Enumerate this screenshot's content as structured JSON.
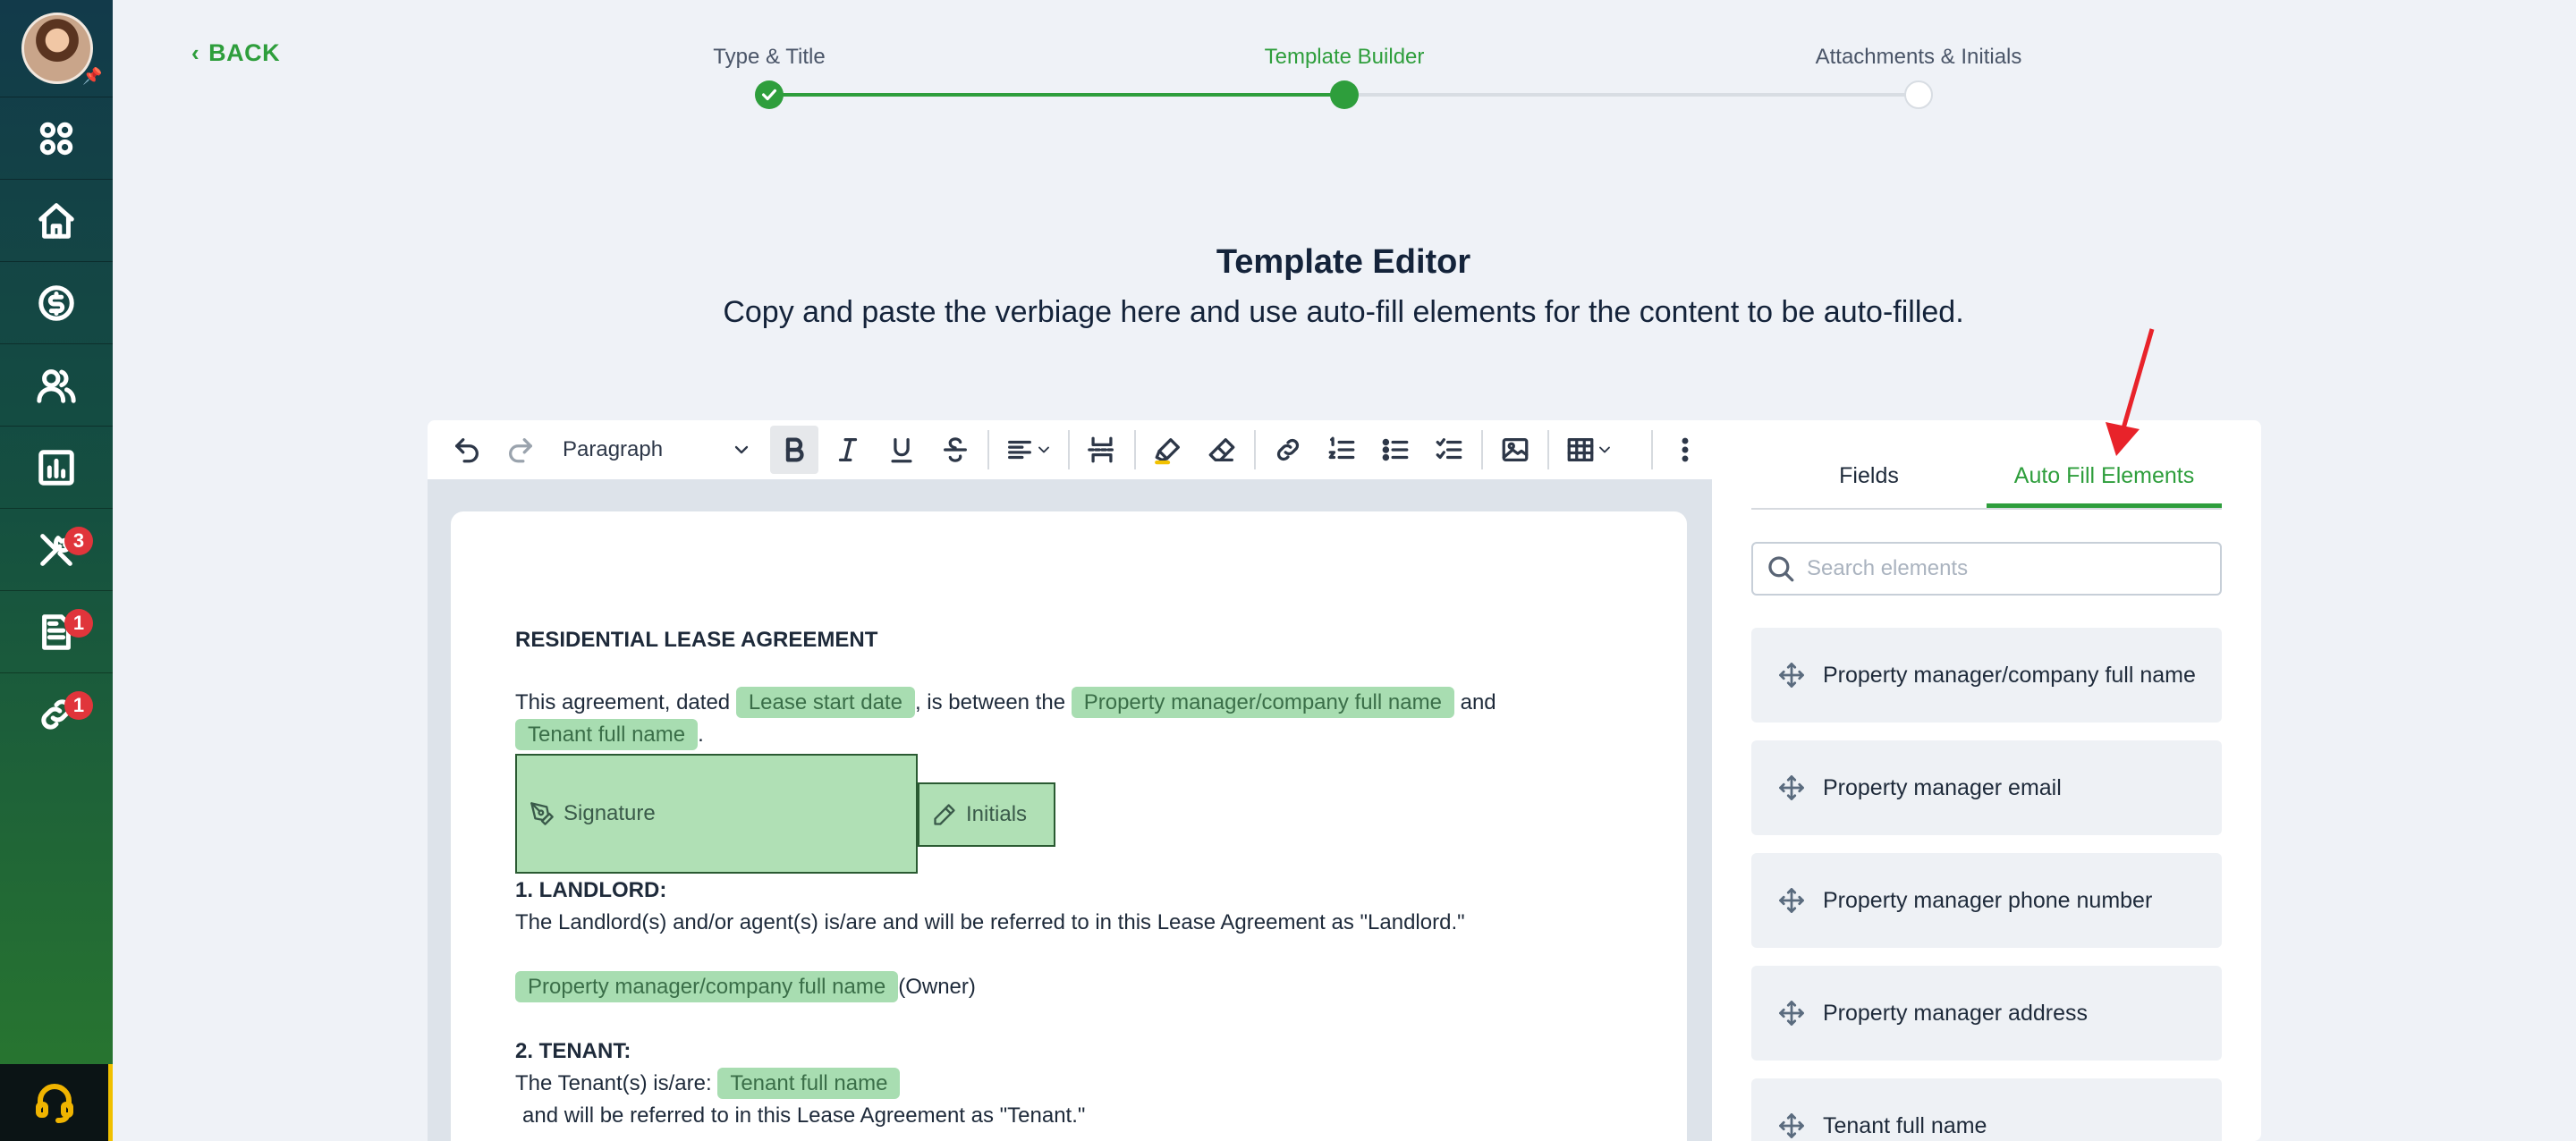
{
  "nav": {
    "back_label": "BACK",
    "items": [
      {
        "name": "apps-icon"
      },
      {
        "name": "home-icon"
      },
      {
        "name": "dollar-icon"
      },
      {
        "name": "users-icon"
      },
      {
        "name": "chart-icon"
      },
      {
        "name": "tools-icon",
        "badge": "3"
      },
      {
        "name": "document-icon",
        "badge": "1"
      },
      {
        "name": "link-icon",
        "badge": "1"
      }
    ],
    "support_icon": "headset-icon"
  },
  "stepper": {
    "steps": [
      {
        "label": "Type & Title",
        "state": "complete"
      },
      {
        "label": "Template Builder",
        "state": "active"
      },
      {
        "label": "Attachments & Initials",
        "state": "pending"
      }
    ],
    "accent_color": "#2e9e3c"
  },
  "header": {
    "title": "Template Editor",
    "subtitle": "Copy and paste the verbiage here and use auto-fill elements for the content to be auto-filled."
  },
  "toolbar": {
    "paragraph_style": "Paragraph"
  },
  "document": {
    "heading": "RESIDENTIAL LEASE AGREEMENT",
    "intro_prefix": "This agreement, dated",
    "intro_chip_1": "Lease start date",
    "intro_mid": ", is between the",
    "intro_chip_2": "Property manager/company full name",
    "intro_and": "and",
    "intro_chip_3": "Tenant full name",
    "intro_end": ".",
    "signature_label": "Signature",
    "initials_label": "Initials",
    "landlord_heading": "1. LANDLORD:",
    "landlord_text": "The Landlord(s) and/or agent(s) is/are and will be referred to in this Lease Agreement as \"Landlord.\"",
    "landlord_chip": "Property manager/company full name",
    "landlord_suffix": "(Owner)",
    "tenant_heading": "2. TENANT:",
    "tenant_prefix": "The Tenant(s) is/are:",
    "tenant_chip": "Tenant full name",
    "tenant_text": "and will be referred to in this Lease Agreement as \"Tenant.\""
  },
  "panel": {
    "tabs": [
      "Fields",
      "Auto Fill Elements"
    ],
    "active_tab": "Auto Fill Elements",
    "search_placeholder": "Search elements",
    "elements": [
      "Property manager/company full name",
      "Property manager email",
      "Property manager phone number",
      "Property manager address",
      "Tenant full name"
    ]
  }
}
